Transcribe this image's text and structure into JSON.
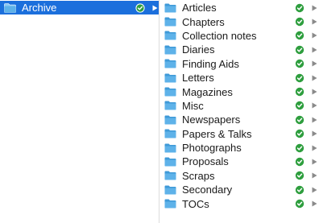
{
  "colors": {
    "selection": "#1b6fdc",
    "folder": "#5eb2e9",
    "folder_dark": "#3f9ad8",
    "synced": "#2e9e3e",
    "chevron": "#8a8a8a"
  },
  "left_column": {
    "items": [
      {
        "label": "Archive",
        "icon": "folder-icon",
        "status": "synced-check-icon",
        "selected": true
      }
    ]
  },
  "right_column": {
    "items": [
      {
        "label": "Articles",
        "icon": "folder-icon",
        "status": "synced-check-icon"
      },
      {
        "label": "Chapters",
        "icon": "folder-icon",
        "status": "synced-check-icon"
      },
      {
        "label": "Collection notes",
        "icon": "folder-icon",
        "status": "synced-check-icon"
      },
      {
        "label": "Diaries",
        "icon": "folder-icon",
        "status": "synced-check-icon"
      },
      {
        "label": "Finding Aids",
        "icon": "folder-icon",
        "status": "synced-check-icon"
      },
      {
        "label": "Letters",
        "icon": "folder-icon",
        "status": "synced-check-icon"
      },
      {
        "label": "Magazines",
        "icon": "folder-icon",
        "status": "synced-check-icon"
      },
      {
        "label": "Misc",
        "icon": "folder-icon",
        "status": "synced-check-icon"
      },
      {
        "label": "Newspapers",
        "icon": "folder-icon",
        "status": "synced-check-icon"
      },
      {
        "label": "Papers & Talks",
        "icon": "folder-icon",
        "status": "synced-check-icon"
      },
      {
        "label": "Photographs",
        "icon": "folder-icon",
        "status": "synced-check-icon"
      },
      {
        "label": "Proposals",
        "icon": "folder-icon",
        "status": "synced-check-icon"
      },
      {
        "label": "Scraps",
        "icon": "folder-icon",
        "status": "synced-check-icon"
      },
      {
        "label": "Secondary",
        "icon": "folder-icon",
        "status": "synced-check-icon"
      },
      {
        "label": "TOCs",
        "icon": "folder-icon",
        "status": "synced-check-icon"
      }
    ]
  }
}
